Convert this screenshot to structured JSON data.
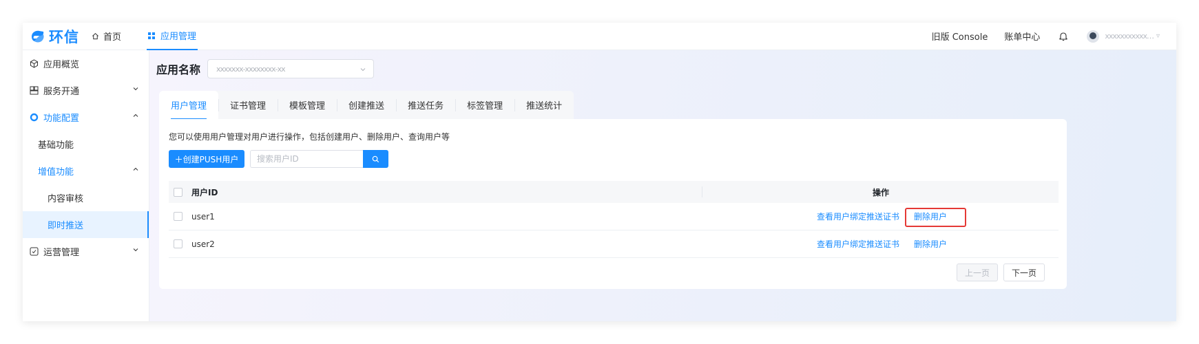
{
  "brand": {
    "name": "环信",
    "color": "#1a8cff"
  },
  "topnav": {
    "home": "首页",
    "apps": "应用管理",
    "old_console": "旧版 Console",
    "billing": "账单中心",
    "user_name": "xxxxxxxxxxx…",
    "icons": [
      "home-icon",
      "grid-icon",
      "bell-icon",
      "avatar"
    ]
  },
  "sidebar": {
    "items": [
      {
        "label": "应用概览",
        "icon": "cube-icon"
      },
      {
        "label": "服务开通",
        "icon": "server-icon"
      },
      {
        "label": "功能配置",
        "icon": "circle-icon"
      },
      {
        "label": "基础功能"
      },
      {
        "label": "增值功能"
      },
      {
        "label": "内容审核"
      },
      {
        "label": "即时推送"
      },
      {
        "label": "运营管理",
        "icon": "checklist-icon"
      }
    ]
  },
  "app": {
    "label": "应用名称",
    "selected": "xxxxxxx-xxxxxxxx-xx"
  },
  "tabs": [
    "用户管理",
    "证书管理",
    "模板管理",
    "创建推送",
    "推送任务",
    "标签管理",
    "推送统计"
  ],
  "panel": {
    "description": "您可以使用用户管理对用户进行操作，包括创建用户、删除用户、查询用户等",
    "create_button": "＋创建PUSH用户",
    "search_placeholder": "搜索用户ID"
  },
  "table": {
    "headers": {
      "id": "用户ID",
      "ops": "操作"
    },
    "rows": [
      {
        "id": "user1",
        "op_bind": "查看用户绑定推送证书",
        "op_delete": "删除用户"
      },
      {
        "id": "user2",
        "op_bind": "查看用户绑定推送证书",
        "op_delete": "删除用户"
      }
    ]
  },
  "pager": {
    "prev": "上一页",
    "next": "下一页"
  },
  "colors": {
    "accent": "#1a8cff",
    "highlight": "#e53935"
  }
}
